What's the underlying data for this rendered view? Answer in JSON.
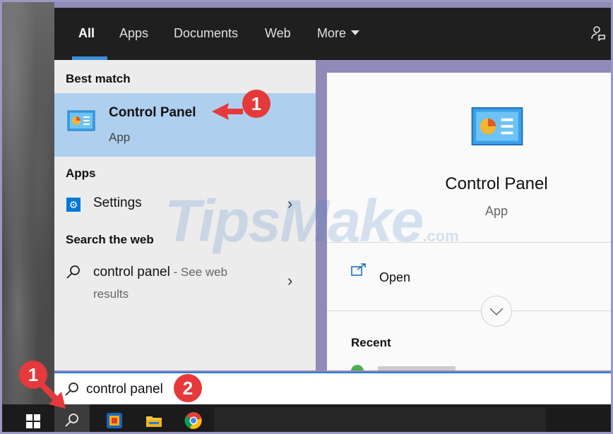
{
  "tabs": [
    {
      "label": "All",
      "active": true
    },
    {
      "label": "Apps"
    },
    {
      "label": "Documents"
    },
    {
      "label": "Web"
    },
    {
      "label": "More"
    }
  ],
  "icons": {
    "feedback": "feedback-icon",
    "control_panel": "control-panel-icon",
    "settings": "gear-icon",
    "search": "search-icon",
    "open": "open-icon",
    "expand": "chevron-down-icon",
    "start": "windows-logo-icon"
  },
  "results": {
    "best_match_heading": "Best match",
    "best_match": {
      "name": "Control Panel",
      "type": "App"
    },
    "apps_heading": "Apps",
    "apps": [
      {
        "label": "Settings"
      }
    ],
    "web_heading": "Search the web",
    "web": {
      "query": "control panel",
      "suffix": " - See web",
      "line2": "results"
    }
  },
  "preview": {
    "name": "Control Panel",
    "type": "App",
    "open_label": "Open",
    "recent_heading": "Recent"
  },
  "search": {
    "value": "control panel"
  },
  "annotations": [
    {
      "label": "1"
    },
    {
      "label": "2"
    },
    {
      "label": "1"
    }
  ],
  "watermark": {
    "main": "TipsMake",
    "suffix": ".com"
  },
  "colors": {
    "selection": "#aecfee",
    "accent": "#3a8fd9",
    "annotation": "#e5393b"
  }
}
